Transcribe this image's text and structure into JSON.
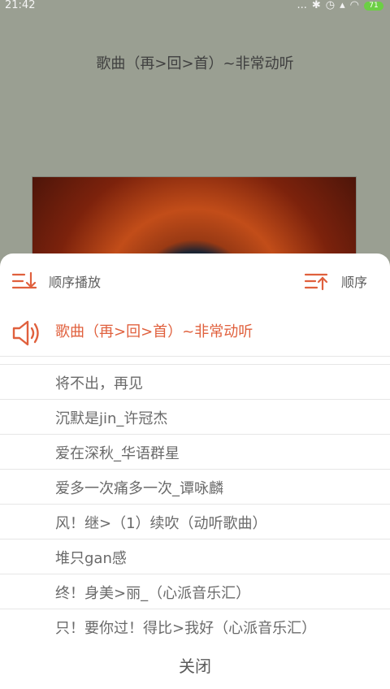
{
  "status_bar": {
    "time": "21:42",
    "signal_dots": "...",
    "battery": "71"
  },
  "player": {
    "song_title": "歌曲（再>回>首）~非常动听"
  },
  "playlist_sheet": {
    "mode_left_label": "顺序播放",
    "mode_right_label": "顺序",
    "current_song": "歌曲（再>回>首）~非常动听",
    "songs": [
      "将不出，再见",
      "沉默是jin_许冠杰",
      "爱在深秋_华语群星",
      "爱多一次痛多一次_谭咏麟",
      "风！继>（1）续吹（动听歌曲）",
      "堆只gan感",
      "终！身美>丽_（心派音乐汇）",
      "只！要你过！得比>我好（心派音乐汇）"
    ],
    "close_label": "关闭"
  },
  "colors": {
    "accent": "#e0603d",
    "overlay_bg": "#9a9f92"
  }
}
